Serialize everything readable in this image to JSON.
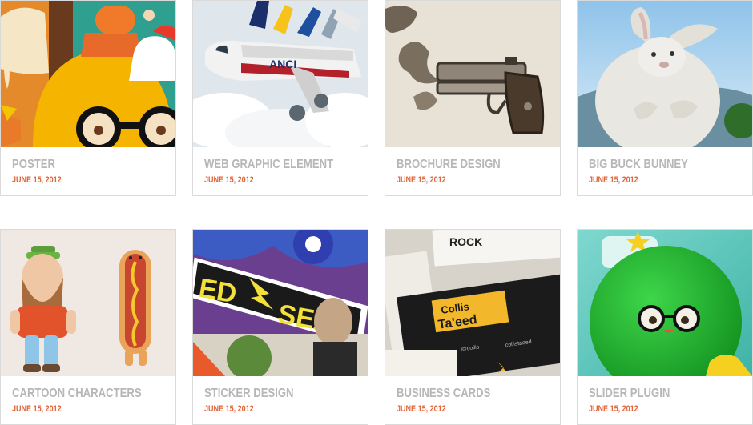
{
  "portfolio": {
    "items": [
      {
        "title": "POSTER",
        "date": "JUNE 15, 2012",
        "thumbnail_icon": "poster-illustration-icon"
      },
      {
        "title": "WEB GRAPHIC ELEMENT",
        "date": "JUNE 15, 2012",
        "thumbnail_icon": "airplanes-illustration-icon"
      },
      {
        "title": "BROCHURE DESIGN",
        "date": "JUNE 15, 2012",
        "thumbnail_icon": "pistol-illustration-icon"
      },
      {
        "title": "BIG BUCK BUNNEY",
        "date": "JUNE 15, 2012",
        "thumbnail_icon": "bunny-illustration-icon"
      },
      {
        "title": "CARTOON CHARACTERS",
        "date": "JUNE 15, 2012",
        "thumbnail_icon": "toy-figures-icon"
      },
      {
        "title": "STICKER DESIGN",
        "date": "JUNE 15, 2012",
        "thumbnail_icon": "stickers-illustration-icon"
      },
      {
        "title": "BUSINESS CARDS",
        "date": "JUNE 15, 2012",
        "thumbnail_icon": "business-cards-icon"
      },
      {
        "title": "SLIDER PLUGIN",
        "date": "JUNE 15, 2012",
        "thumbnail_icon": "green-ball-character-icon"
      }
    ],
    "thumbnail_text": {
      "airplane_livery": "ANCI",
      "sticker_left": "ED",
      "sticker_right": "SEAR",
      "card_name_1": "Collis",
      "card_name_2": "Ta'eed",
      "card_handle_1": "@collis",
      "card_handle_2": "collistaeed",
      "card_back_text": "ROCK"
    }
  },
  "colors": {
    "title_text": "#b7b7b7",
    "date_text": "#e0663a",
    "card_border": "#dadada"
  }
}
